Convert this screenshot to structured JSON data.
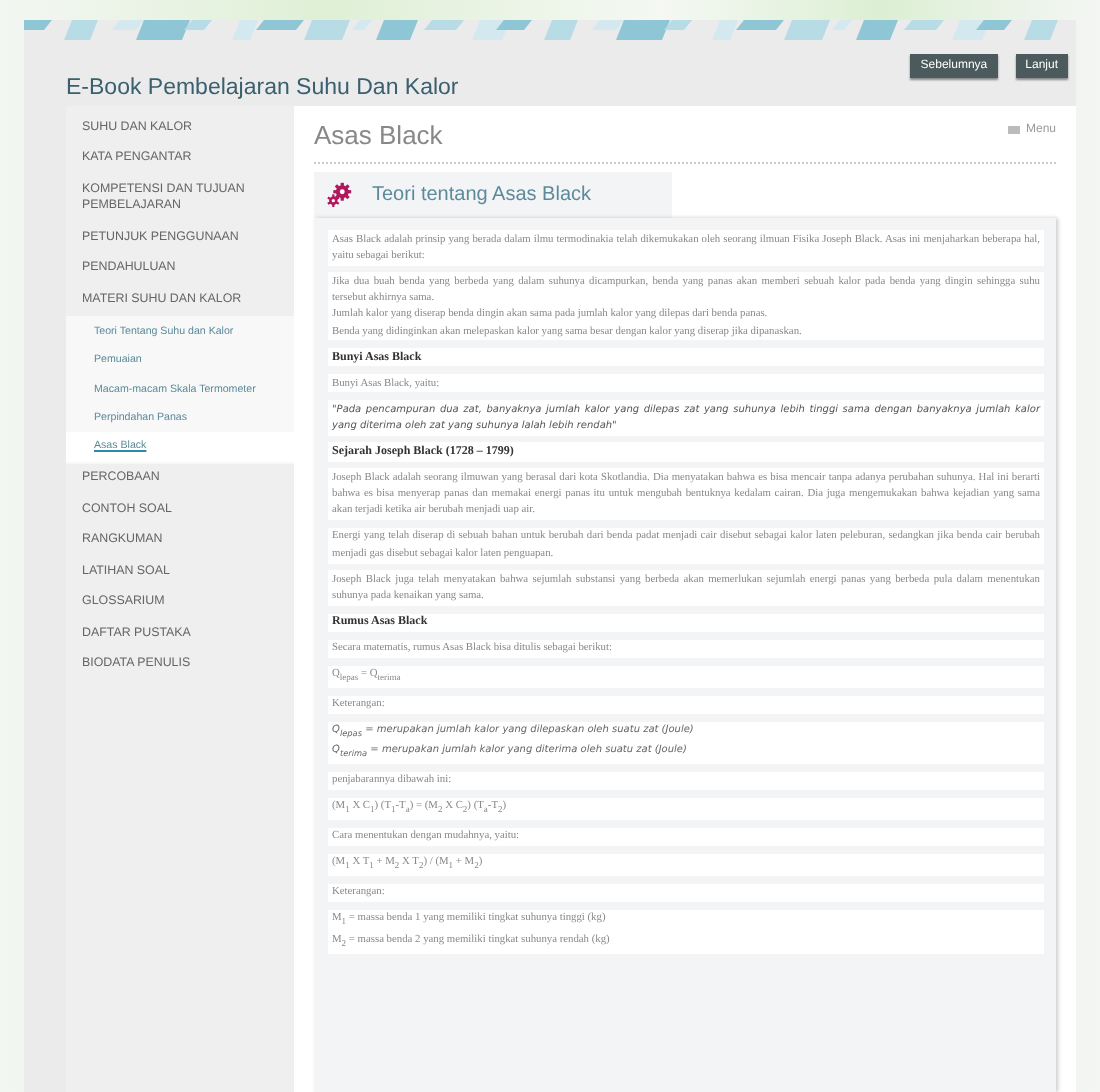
{
  "header": {
    "title": "E-Book Pembelajaran Suhu Dan Kalor",
    "buttons": [
      "Sebelumnya",
      "Lanjut"
    ]
  },
  "sidebar": {
    "items": [
      {
        "label": "SUHU DAN KALOR",
        "selected": false
      },
      {
        "label": "KATA PENGANTAR",
        "selected": false
      },
      {
        "label": "KOMPETENSI DAN TUJUAN PEMBELAJARAN",
        "selected": false
      },
      {
        "label": "PETUNJUK PENGGUNAAN",
        "selected": false
      },
      {
        "label": "PENDAHULUAN",
        "selected": false
      },
      {
        "label": "MATERI SUHU DAN KALOR",
        "selected": false,
        "children": [
          {
            "label": "Teori Tentang Suhu dan Kalor",
            "selected": false
          },
          {
            "label": "Pemuaian",
            "selected": false
          },
          {
            "label": "Macam-macam Skala Termometer",
            "selected": false
          },
          {
            "label": "Perpindahan Panas",
            "selected": false
          },
          {
            "label": "Asas Black",
            "selected": true
          }
        ]
      },
      {
        "label": "PERCOBAAN",
        "selected": false
      },
      {
        "label": "CONTOH SOAL",
        "selected": false
      },
      {
        "label": "RANGKUMAN",
        "selected": false
      },
      {
        "label": "LATIHAN SOAL",
        "selected": false
      },
      {
        "label": "GLOSSARIUM",
        "selected": false
      },
      {
        "label": "DAFTAR PUSTAKA",
        "selected": false
      },
      {
        "label": "BIODATA PENULIS",
        "selected": false
      }
    ]
  },
  "page": {
    "title": "Asas Black",
    "menu": "Menu"
  },
  "section": {
    "title": "Teori tentang Asas Black",
    "blocks": [
      {
        "kind": "text",
        "lines": [
          "Asas Black adalah prinsip yang berada dalam ilmu termodinakia telah dikemukakan oleh seorang ilmuan Fisika Joseph Black. Asas ini menjaharkan beberapa hal, yaitu sebagai berikut:"
        ]
      },
      {
        "kind": "text",
        "lines": [
          "Jika dua buah benda yang berbeda yang dalam suhunya dicampurkan, benda yang panas akan memberi sebuah kalor pada benda yang dingin sehingga suhu tersebut akhirnya sama.",
          "Jumlah kalor yang diserap benda dingin akan sama pada jumlah kalor yang dilepas dari benda panas.",
          "Benda yang didinginkan akan melepaskan kalor yang sama besar dengan kalor yang diserap jika dipanaskan."
        ]
      },
      {
        "kind": "heading",
        "lines": [
          "Bunyi Asas Black"
        ]
      },
      {
        "kind": "text",
        "lines": [
          "Bunyi Asas Black, yaitu:"
        ]
      },
      {
        "kind": "quote",
        "lines": [
          "\"Pada pencampuran dua zat, banyaknya jumlah kalor yang dilepas zat yang suhunya lebih tinggi sama dengan banyaknya jumlah kalor yang diterima oleh zat yang suhunya lalah lebih rendah\""
        ]
      },
      {
        "kind": "heading",
        "lines": [
          "Sejarah Joseph Black (1728 – 1799)"
        ]
      },
      {
        "kind": "text",
        "lines": [
          "Joseph Black adalah seorang ilmuwan yang berasal dari kota Skotlandia. Dia menyatakan bahwa es bisa mencair tanpa adanya perubahan suhunya. Hal ini berarti bahwa es bisa menyerap panas dan memakai energi panas itu untuk mengubah bentuknya kedalam cairan. Dia juga mengemukakan bahwa kejadian yang sama akan terjadi ketika air berubah menjadi uap air."
        ]
      },
      {
        "kind": "text",
        "lines": [
          "Energi yang telah diserap di sebuah bahan untuk berubah dari benda padat menjadi cair disebut sebagai kalor laten peleburan, sedangkan jika benda cair berubah menjadi gas disebut sebagai kalor laten penguapan."
        ]
      },
      {
        "kind": "text",
        "lines": [
          "Joseph Black juga telah menyatakan bahwa sejumlah substansi yang berbeda akan memerlukan sejumlah energi panas yang berbeda pula dalam menentukan suhunya pada kenaikan yang sama."
        ]
      },
      {
        "kind": "heading",
        "lines": [
          "Rumus Asas Black"
        ]
      },
      {
        "kind": "text",
        "lines": [
          "Secara matematis, rumus Asas Black bisa ditulis sebagai berikut:"
        ]
      },
      {
        "kind": "text",
        "lines": [
          "Q$_{lepas}$ = Q$_{terima}$"
        ]
      },
      {
        "kind": "text",
        "lines": [
          "Keterangan:"
        ]
      },
      {
        "kind": "note",
        "lines": [
          "Q$_{lepas}$ = merupakan jumlah kalor yang dilepaskan oleh suatu zat (Joule)",
          "Q$_{terima}$ = merupakan jumlah kalor yang diterima oleh suatu zat (Joule)"
        ]
      },
      {
        "kind": "text",
        "lines": [
          "penjabarannya dibawah ini:"
        ]
      },
      {
        "kind": "text",
        "lines": [
          "(M$_{1}$ X C$_{1}$) (T$_{1}$-T$_{a}$) = (M$_{2}$ X C$_{2}$) (T$_{a}$-T$_{2}$)"
        ]
      },
      {
        "kind": "text",
        "lines": [
          "Cara menentukan dengan mudahnya, yaitu:"
        ]
      },
      {
        "kind": "text",
        "lines": [
          "(M$_{1}$ X T$_{1}$ + M$_{2}$ X T$_{2}$) / (M$_{1}$ + M$_{2}$)"
        ]
      },
      {
        "kind": "text",
        "lines": [
          "Keterangan:"
        ]
      },
      {
        "kind": "text",
        "lines": [
          "M$_{1}$ = massa benda 1 yang memiliki tingkat suhunya tinggi (kg)",
          "M$_{2}$ = massa benda 2 yang memiliki tingkat suhunya rendah (kg)"
        ]
      }
    ]
  }
}
